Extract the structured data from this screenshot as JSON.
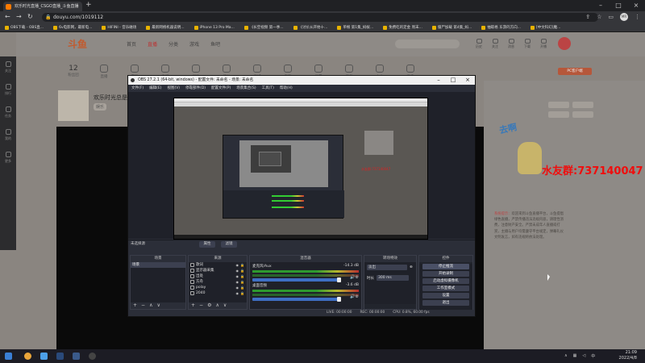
{
  "browser": {
    "tab_title": "欢乐时光直播_CSGO直播_斗鱼直播",
    "url": "douyu.com/1019112",
    "bookmarks": [
      "OBS下载 - OBS直...",
      "6v电影网，最新电...",
      "HIFINI - 音乐磁场",
      "最新网络机器说明...",
      "iPhone 13 Pro Ma...",
      "《长空视频 第一季...",
      "《讨价从开始十...",
      "单根 第1集_蚂蚁...",
      "免费吃的定金 周末...",
      "僵尸加载 第4集_蚂...",
      "抽取格 东游的方向...",
      "[中文科幻]魔..."
    ]
  },
  "site": {
    "logo": "斗鱼",
    "nav": [
      "首页",
      "直播",
      "分类",
      "游戏",
      "鱼吧"
    ],
    "nav_active_index": 1,
    "header_icons": [
      "历史",
      "关注",
      "消息",
      "下载",
      "开播"
    ],
    "categories": [
      {
        "label": "粉丝团",
        "count": "12"
      },
      {
        "label": "直播"
      },
      {
        "label": "游戏"
      },
      {
        "label": "鱼吧"
      },
      {
        "label": "娱乐"
      },
      {
        "label": "活动"
      },
      {
        "label": "商城"
      },
      {
        "label": "贵族"
      },
      {
        "label": "设置"
      },
      {
        "label": "任务"
      },
      {
        "label": "中心"
      },
      {
        "label": "更多"
      }
    ],
    "streamer_name": "欢乐时光总是...",
    "streamer_tag": "娱乐",
    "left_rail": [
      "关注",
      "排行",
      "任务",
      "我的",
      "更多"
    ],
    "pc_button": "PC客户端",
    "qq_group": "水友群:737140047",
    "notice_label": "系统提示：",
    "notice_text": "欢迎来到斗鱼直播平台，斗鱼提倡绿色直播，严禁传播违法违规内容，请理性消费，注意财产安全。严禁未成年人直播或打赏，主播与用户均需遵守平台规定，弹幕礼仪文明发言，如有违规将依法处理。"
  },
  "obs": {
    "title": "OBS 27.2.1 (64-bit, windows) - 配置文件: 未命名 - 场景: 未命名",
    "menu": [
      "文件(F)",
      "编辑(E)",
      "视图(V)",
      "停靠部件(D)",
      "配置文件(P)",
      "场景集合(S)",
      "工具(T)",
      "帮助(H)"
    ],
    "scene_label": "未选择源",
    "props_btn": "属性",
    "filter_btn": "滤镜",
    "docks": {
      "scenes": "场景",
      "sources": "来源",
      "mixer": "混音器",
      "transitions": "转场特效",
      "controls": "控件"
    },
    "scenes": [
      "场景"
    ],
    "sources": [
      "歌词",
      "显示器采集",
      "出处",
      "方舟",
      "polay",
      "2040"
    ],
    "mixer": [
      {
        "name": "麦克风/Aux",
        "db": "-14.3 dB"
      },
      {
        "name": "桌面音频",
        "db": "-3.6 dB"
      }
    ],
    "transition": {
      "value": "淡出",
      "duration_label": "时长",
      "duration": "300 ms"
    },
    "controls": [
      "停止推流",
      "开始录制",
      "启动虚拟摄像机",
      "工作室模式",
      "设置",
      "退出"
    ],
    "status": {
      "live": "LIVE: 00:00:00",
      "rec": "REC: 00:00:00",
      "cpu": "CPU: 0.8%, 60.00 fps"
    },
    "capture_red": "水友群:737140047"
  },
  "taskbar": {
    "time": "21:09",
    "date": "2022/4/8"
  }
}
